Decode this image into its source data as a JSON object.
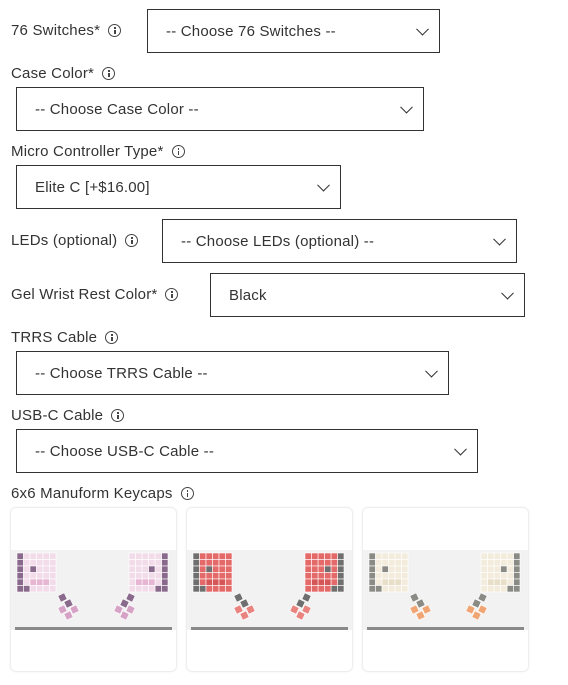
{
  "fields": {
    "switches": {
      "label": "76 Switches*",
      "value": "-- Choose 76 Switches --"
    },
    "case_color": {
      "label": "Case Color*",
      "value": "-- Choose Case Color --"
    },
    "micro_controller": {
      "label": "Micro Controller Type*",
      "value": "Elite C [+$16.00]"
    },
    "leds": {
      "label": "LEDs (optional)",
      "value": "-- Choose LEDs (optional) --"
    },
    "wrist_rest": {
      "label": "Gel Wrist Rest Color*",
      "value": "Black"
    },
    "trrs": {
      "label": "TRRS Cable",
      "value": "-- Choose TRRS Cable --"
    },
    "usbc": {
      "label": "USB-C Cable",
      "value": "-- Choose USB-C Cable --"
    }
  },
  "keycaps": {
    "label": "6x6 Manuform Keycaps",
    "options": [
      {
        "name": "purple-pink",
        "colors": {
          "main": "#f3dcea",
          "mid": "#e6b6d3",
          "dark": "#8a6a8c",
          "accent": "#d6a2c6"
        }
      },
      {
        "name": "red-grey",
        "colors": {
          "main": "#e46a6a",
          "mid": "#d55656",
          "dark": "#6f6f6f",
          "accent": "#e9837f"
        }
      },
      {
        "name": "cream-orange",
        "colors": {
          "main": "#f3ecdc",
          "mid": "#e9dfc8",
          "dark": "#8b8b86",
          "accent": "#f0a674"
        }
      }
    ]
  }
}
